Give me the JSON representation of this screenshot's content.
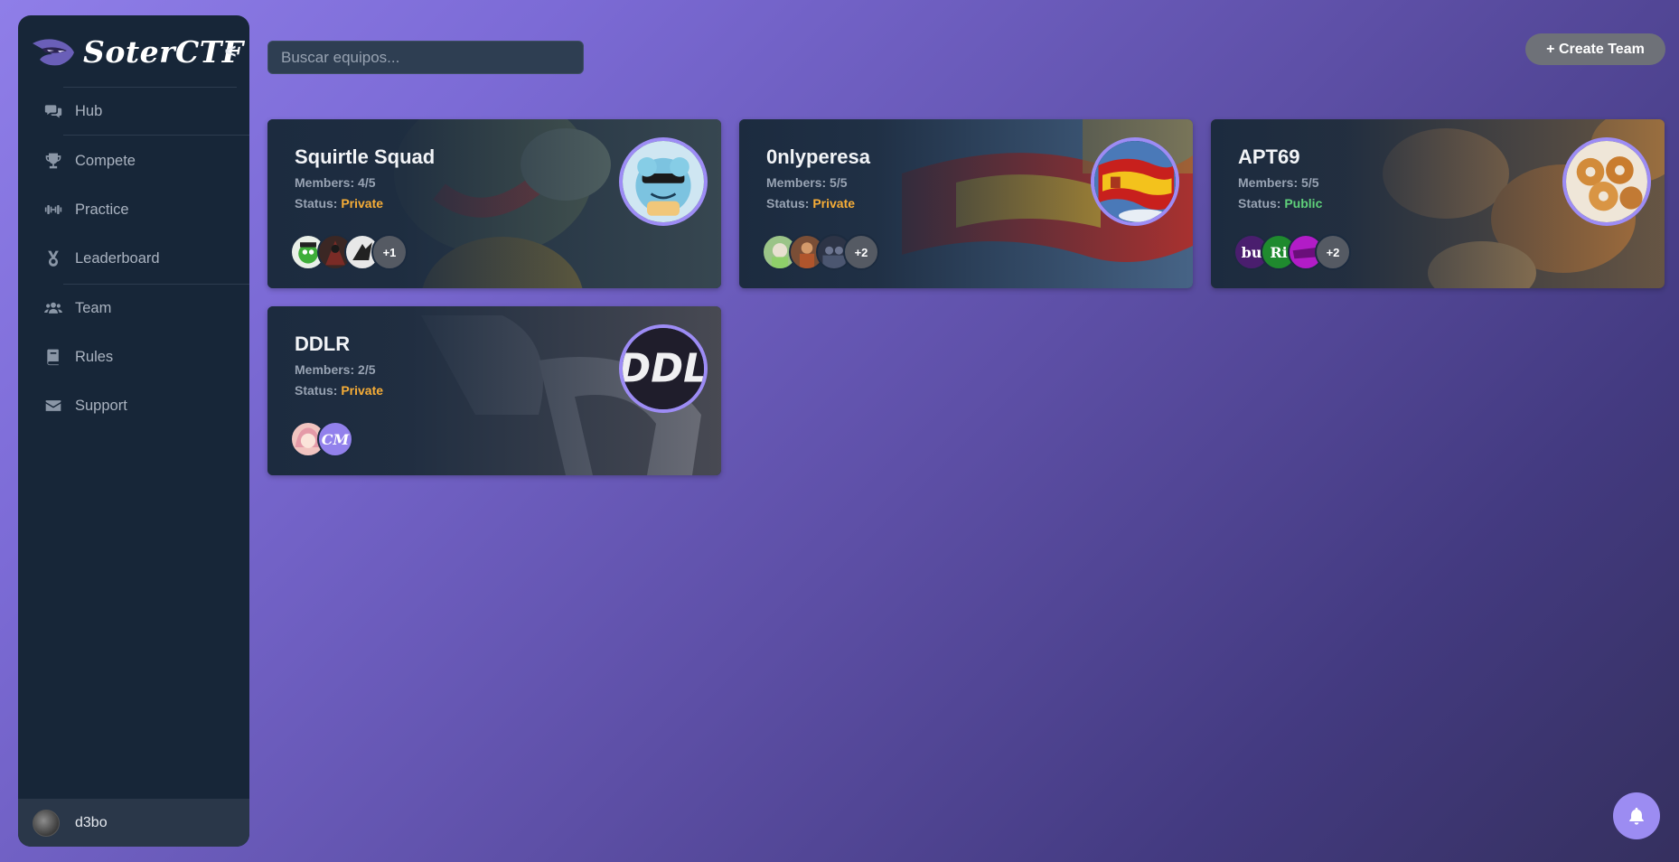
{
  "app": {
    "name": "SoterCTF",
    "collapse_label": "<"
  },
  "sidebar": {
    "items": [
      {
        "label": "Hub",
        "icon": "comments-icon"
      },
      {
        "label": "Compete",
        "icon": "trophy-icon"
      },
      {
        "label": "Practice",
        "icon": "dumbbell-icon"
      },
      {
        "label": "Leaderboard",
        "icon": "medal-icon"
      },
      {
        "label": "Team",
        "icon": "users-icon"
      },
      {
        "label": "Rules",
        "icon": "book-icon"
      },
      {
        "label": "Support",
        "icon": "envelope-icon"
      }
    ],
    "user": {
      "name": "d3bo"
    }
  },
  "search": {
    "placeholder": "Buscar equipos..."
  },
  "create_button": {
    "label": "+ Create Team"
  },
  "colors": {
    "private": "#f6ad37",
    "public": "#5fd17a",
    "accent": "#9d8cf5"
  },
  "teams": [
    {
      "name": "Squirtle Squad",
      "members_label": "Members:",
      "members": "4/5",
      "status_label": "Status:",
      "status": "Private",
      "more": "+1"
    },
    {
      "name": "0nlyperesa",
      "members_label": "Members:",
      "members": "5/5",
      "status_label": "Status:",
      "status": "Private",
      "more": "+2"
    },
    {
      "name": "APT69",
      "members_label": "Members:",
      "members": "5/5",
      "status_label": "Status:",
      "status": "Public",
      "more": "+2",
      "avatars": [
        "bu",
        "Ri"
      ]
    },
    {
      "name": "DDLR",
      "members_label": "Members:",
      "members": "2/5",
      "status_label": "Status:",
      "status": "Private",
      "avatars": [
        "CM"
      ],
      "logo_text": "DDL"
    }
  ]
}
